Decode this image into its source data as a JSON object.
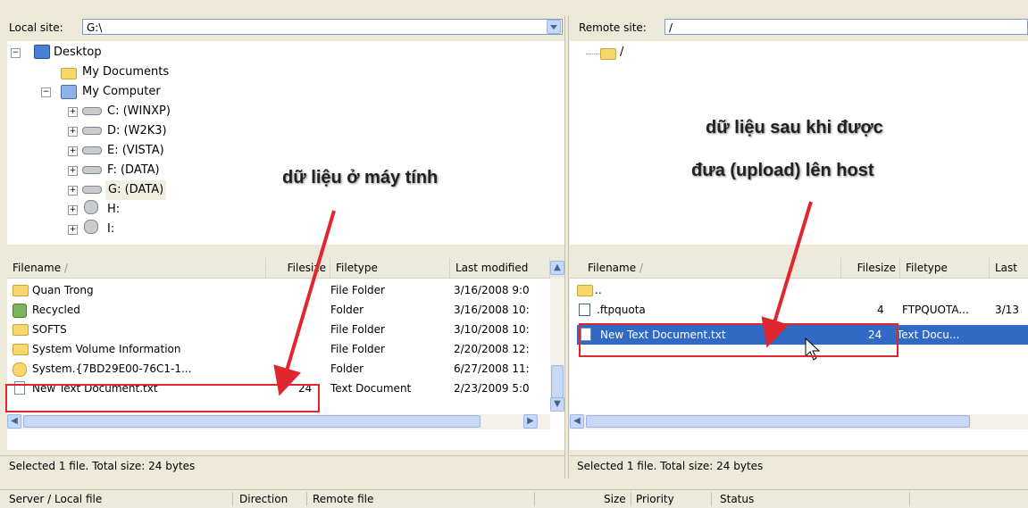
{
  "local": {
    "site_label": "Local site:",
    "site_path": "G:\\",
    "tree": [
      {
        "label": "Desktop",
        "icon": "desktop-icon"
      },
      {
        "label": "My Documents",
        "icon": "folder-icon"
      },
      {
        "label": "My Computer",
        "icon": "computer-icon"
      },
      {
        "label": "C: (WINXP)",
        "icon": "drive-icon"
      },
      {
        "label": "D: (W2K3)",
        "icon": "drive-icon"
      },
      {
        "label": "E: (VISTA)",
        "icon": "drive-icon"
      },
      {
        "label": "F: (DATA)",
        "icon": "drive-icon"
      },
      {
        "label": "G: (DATA)",
        "icon": "drive-icon"
      },
      {
        "label": "H:",
        "icon": "network-drive-icon"
      },
      {
        "label": "I:",
        "icon": "network-drive-icon"
      }
    ],
    "columns": {
      "filename": "Filename",
      "filesize": "Filesize",
      "filetype": "Filetype",
      "modified": "Last modified"
    },
    "files": [
      {
        "name": "Quan Trong",
        "size": "",
        "type": "File Folder",
        "modified": "3/16/2008 9:0",
        "icon": "folder-icon"
      },
      {
        "name": "Recycled",
        "size": "",
        "type": "Folder",
        "modified": "3/16/2008 10:",
        "icon": "recycle-icon"
      },
      {
        "name": "SOFTS",
        "size": "",
        "type": "File Folder",
        "modified": "3/10/2008 10:",
        "icon": "folder-icon"
      },
      {
        "name": "System Volume Information",
        "size": "",
        "type": "File Folder",
        "modified": "2/20/2008 12:",
        "icon": "folder-icon"
      },
      {
        "name": "System.{7BD29E00-76C1-1...",
        "size": "",
        "type": "Folder",
        "modified": "6/27/2008 11:",
        "icon": "system-folder-icon"
      },
      {
        "name": "New Text Document.txt",
        "size": "24",
        "type": "Text Document",
        "modified": "2/23/2009 5:0",
        "icon": "text-file-icon"
      }
    ],
    "status": "Selected 1 file. Total size: 24 bytes"
  },
  "remote": {
    "site_label": "Remote site:",
    "site_path": "/",
    "tree_root": "/",
    "columns": {
      "filename": "Filename",
      "filesize": "Filesize",
      "filetype": "Filetype",
      "modified": "Last"
    },
    "files": [
      {
        "name": "..",
        "size": "",
        "type": "",
        "modified": "",
        "icon": "folder-icon"
      },
      {
        "name": ".ftpquota",
        "size": "4",
        "type": "FTPQUOTA...",
        "modified": "3/13",
        "icon": "ftpquota-file-icon"
      },
      {
        "name": "New Text Document.txt",
        "size": "24",
        "type": "Text Docu...",
        "modified": "",
        "icon": "text-file-icon"
      }
    ],
    "status": "Selected 1 file. Total size: 24 bytes"
  },
  "queue": {
    "columns": [
      "Server / Local file",
      "Direction",
      "Remote file",
      "Size",
      "Priority",
      "Status"
    ]
  },
  "annotations": {
    "local": "dữ liệu ở máy tính",
    "remote_line1": "dữ liệu sau khi được",
    "remote_line2": "đưa (upload) lên host"
  },
  "colors": {
    "highlight": "#e0262e",
    "selection": "#316ac5",
    "arrow": "#e0262e"
  }
}
